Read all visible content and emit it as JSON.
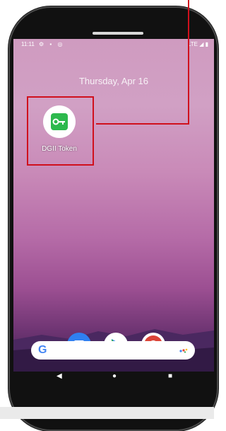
{
  "status_bar": {
    "time": "11:11",
    "left_icons": "⚙ ▪ ◎",
    "right_icons": "LTE ◢ ▮"
  },
  "home": {
    "date": "Thursday, Apr 16",
    "app": {
      "label": "DGII Token",
      "icon": "key-icon"
    }
  },
  "dock": [
    {
      "name": "messages",
      "icon": "messages-icon"
    },
    {
      "name": "play-store",
      "icon": "play-store-icon"
    },
    {
      "name": "chrome",
      "icon": "chrome-icon"
    }
  ],
  "search": {
    "logo": "G",
    "icon": "assistant-icon"
  },
  "nav": {
    "back": "◀",
    "home": "●",
    "recents": "■"
  },
  "colors": {
    "annotation": "#d0101d",
    "app_green": "#2db94d"
  }
}
